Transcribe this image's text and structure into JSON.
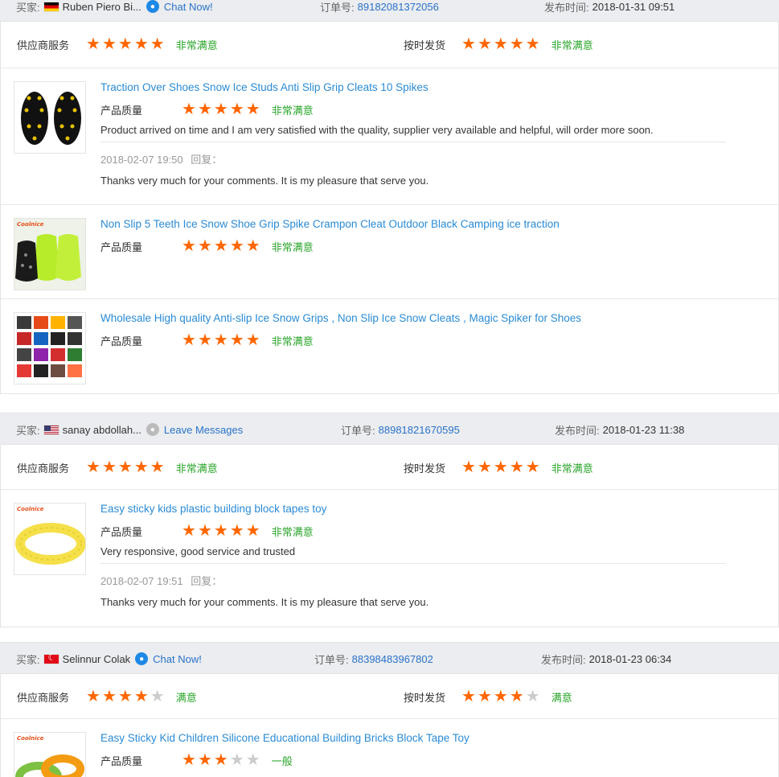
{
  "labels": {
    "buyer": "买家:",
    "order_no": "订单号:",
    "publish_time": "发布时间:",
    "supplier_service": "供应商服务",
    "on_time_shipping": "按时发货",
    "product_quality": "产品质量",
    "reply": "回复："
  },
  "colors": {
    "star_on": "#ff6600",
    "star_off": "#cccccc",
    "satisfied": "#2aa52a",
    "link": "#2a72c9",
    "header_bg": "#ebedf0"
  },
  "orders": [
    {
      "buyer": "Ruben Piero Bi...",
      "flag": "de",
      "chat_label": "Chat Now!",
      "chat_icon": "chat-online-icon",
      "order_no": "89182081372056",
      "time": "2018-01-31 09:51",
      "supplier_rating": 5,
      "supplier_text": "非常满意",
      "shipping_rating": 5,
      "shipping_text": "非常满意",
      "products": [
        {
          "title": "Traction Over Shoes Snow Ice Studs Anti Slip Grip Cleats 10 Spikes",
          "rating": 5,
          "rating_text": "非常满意",
          "comment": "Product arrived on time and I am very satisfied with the quality, supplier very available and helpful, will order more soon.",
          "reply_time": "2018-02-07 19:50",
          "reply_text": "Thanks very much for your comments. It is my pleasure that serve you."
        },
        {
          "title": "Non Slip 5 Teeth Ice Snow Shoe Grip Spike Crampon Cleat Outdoor Black Camping ice traction",
          "rating": 5,
          "rating_text": "非常满意",
          "brand": "Coolnice"
        },
        {
          "title": "Wholesale High quality Anti-slip Ice Snow Grips , Non Slip Ice Snow Cleats , Magic Spiker for Shoes",
          "rating": 5,
          "rating_text": "非常满意"
        }
      ]
    },
    {
      "buyer": "sanay abdollah...",
      "flag": "us",
      "chat_label": "Leave Messages",
      "chat_icon": "chat-offline-icon",
      "order_no": "88981821670595",
      "time": "2018-01-23 11:38",
      "supplier_rating": 5,
      "supplier_text": "非常满意",
      "shipping_rating": 5,
      "shipping_text": "非常满意",
      "products": [
        {
          "title": "Easy sticky kids plastic building block tapes toy",
          "rating": 5,
          "rating_text": "非常满意",
          "brand": "Coolnice",
          "comment": "Very responsive, good service and trusted",
          "reply_time": "2018-02-07 19:51",
          "reply_text": "Thanks very much for your comments. It is my pleasure that serve you."
        }
      ]
    },
    {
      "buyer": "Selinnur Colak",
      "flag": "tr",
      "chat_label": "Chat Now!",
      "chat_icon": "chat-online-icon",
      "order_no": "88398483967802",
      "time": "2018-01-23 06:34",
      "supplier_rating": 4,
      "supplier_text": "满意",
      "shipping_rating": 4,
      "shipping_text": "满意",
      "products": [
        {
          "title": "Easy Sticky Kid Children Silicone Educational Building Bricks Block Tape Toy",
          "rating": 3,
          "rating_text": "一般",
          "brand": "Coolnice"
        }
      ]
    }
  ]
}
